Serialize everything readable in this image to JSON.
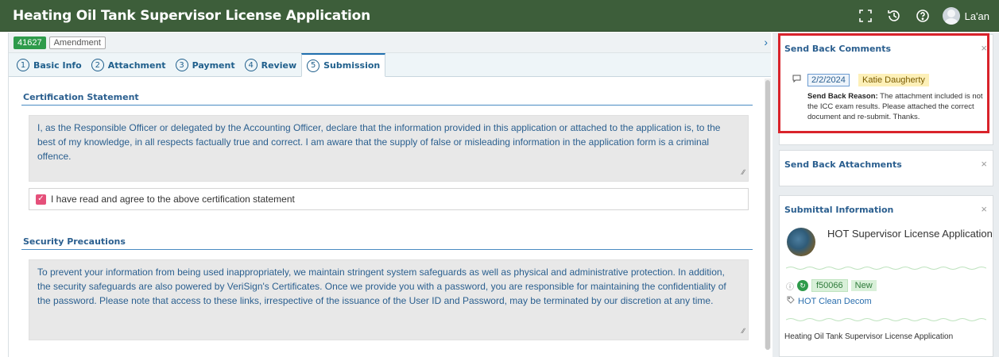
{
  "header": {
    "title": "Heating Oil Tank Supervisor License Application",
    "icons": [
      "fullscreen-icon",
      "history-icon",
      "help-icon",
      "user-avatar"
    ],
    "user_name": "La'an"
  },
  "record": {
    "id": "41627",
    "type": "Amendment"
  },
  "tabs": [
    {
      "num": "1",
      "label": "Basic Info"
    },
    {
      "num": "2",
      "label": "Attachment"
    },
    {
      "num": "3",
      "label": "Payment"
    },
    {
      "num": "4",
      "label": "Review"
    },
    {
      "num": "5",
      "label": "Submission"
    }
  ],
  "certification": {
    "title": "Certification Statement",
    "text": "I, as the Responsible Officer or delegated by the Accounting Officer, declare that the information provided in this application or attached to the application is, to the best of my knowledge, in all respects factually true and correct. I am aware that the supply of false or misleading information in the application form is a criminal offence.",
    "agree_label": "I have read and agree to the above certification statement",
    "agree_checked": true
  },
  "security": {
    "title": "Security Precautions",
    "text": "To prevent your information from being used inappropriately, we maintain stringent system safeguards as well as physical and administrative protection. In addition, the security safeguards are also powered by VeriSign's Certificates. Once we provide you with a password, you are responsible for maintaining the confidentiality of the password. Please note that access to these links, irrespective of the issuance of the User ID and Password, may be terminated by our discretion at any time."
  },
  "side": {
    "send_back_comments": {
      "title": "Send Back Comments",
      "date": "2/2/2024",
      "author": "Katie Daugherty",
      "reason_label": "Send Back Reason:",
      "reason_text": "The attachment included is not the ICC exam results. Please attached the correct document and re-submit. Thanks."
    },
    "send_back_attachments": {
      "title": "Send Back Attachments"
    },
    "submittal": {
      "title": "Submittal Information",
      "name": "HOT Supervisor License Application",
      "number": "f50066",
      "status": "New",
      "tag": "HOT Clean Decom",
      "footer": "Heating Oil Tank Supervisor License Application"
    }
  },
  "colors": {
    "header_bg": "#3d5e3a",
    "accent": "#2b5f8f",
    "highlight": "#d9232b",
    "checkbox": "#e5507a",
    "id_badge": "#2e9b4b"
  }
}
